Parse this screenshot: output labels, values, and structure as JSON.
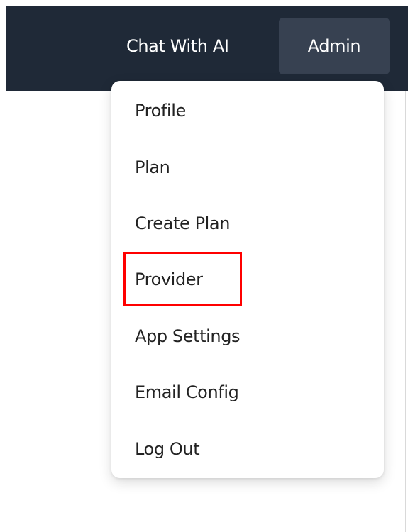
{
  "navbar": {
    "chat_link": "Chat With AI",
    "admin_button": "Admin"
  },
  "dropdown": {
    "items": [
      {
        "label": "Profile"
      },
      {
        "label": "Plan"
      },
      {
        "label": "Create Plan"
      },
      {
        "label": "Provider",
        "highlighted": true
      },
      {
        "label": "App Settings"
      },
      {
        "label": "Email Config"
      },
      {
        "label": "Log Out"
      }
    ]
  },
  "colors": {
    "navbar_bg": "#1f2937",
    "admin_button_bg": "#374151",
    "highlight": "#ff0000"
  }
}
